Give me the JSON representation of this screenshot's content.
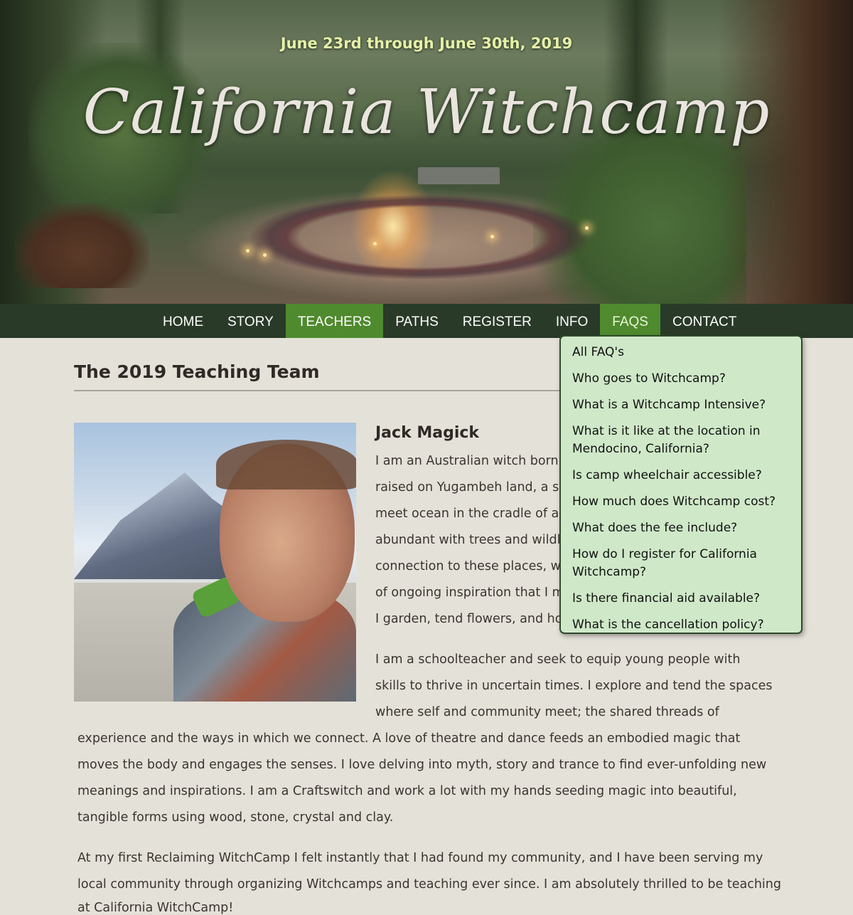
{
  "hero": {
    "dates": "June 23rd through June 30th, 2019",
    "site_title": "California Witchcamp"
  },
  "nav": {
    "items": [
      "HOME",
      "STORY",
      "TEACHERS",
      "PATHS",
      "REGISTER",
      "INFO",
      "FAQS",
      "CONTACT"
    ],
    "active": "TEACHERS",
    "hovered": "FAQS",
    "active_color": "#4f8a2e",
    "bar_color": "#2a3a28"
  },
  "faq_menu": {
    "items": [
      "All FAQ's",
      "Who goes to Witchcamp?",
      "What is a Witchcamp Intensive?",
      "What is it like at the location in Mendocino, California?",
      "Is camp wheelchair accessible?",
      "How much does Witchcamp cost?",
      "What does the fee include?",
      "How do I register for California Witchcamp?",
      "Is there financial aid available?",
      "What is the cancellation policy?"
    ],
    "background": "#cfe8c8"
  },
  "content": {
    "heading": "The 2019 Teaching Team",
    "teacher": {
      "name": "Jack Magick",
      "photo": "portrait-photo",
      "paragraph1_lines": [
        "I am an Australian witch born",
        "raised on Yugambeh land, a sp",
        "meet ocean in the cradle of a l",
        "abundant with trees and wildl",
        "connection to these places, wh",
        "of ongoing inspiration that I m",
        "I garden, tend flowers, and ho"
      ],
      "paragraph2_lines": [
        "I am a schoolteacher and seek to equip young people with",
        "skills to thrive in uncertain times. I explore and tend the spaces",
        "where self and community meet; the shared threads of",
        "experience and the ways in which we connect. A love of theatre and dance feeds an embodied magic that",
        "moves the body and engages the senses. I love delving into myth, story and trance to find ever-unfolding new",
        "meanings and inspirations. I am a Craftswitch and work a lot with my hands seeding magic into beautiful,",
        "tangible forms using wood, stone, crystal and clay."
      ],
      "paragraph3_lines": [
        "At my first Reclaiming WitchCamp I felt instantly that I had found my community, and I have been serving my",
        "local community through organizing Witchcamps and teaching ever since. I am absolutely thrilled to be teaching",
        "at California WitchCamp!"
      ]
    }
  }
}
